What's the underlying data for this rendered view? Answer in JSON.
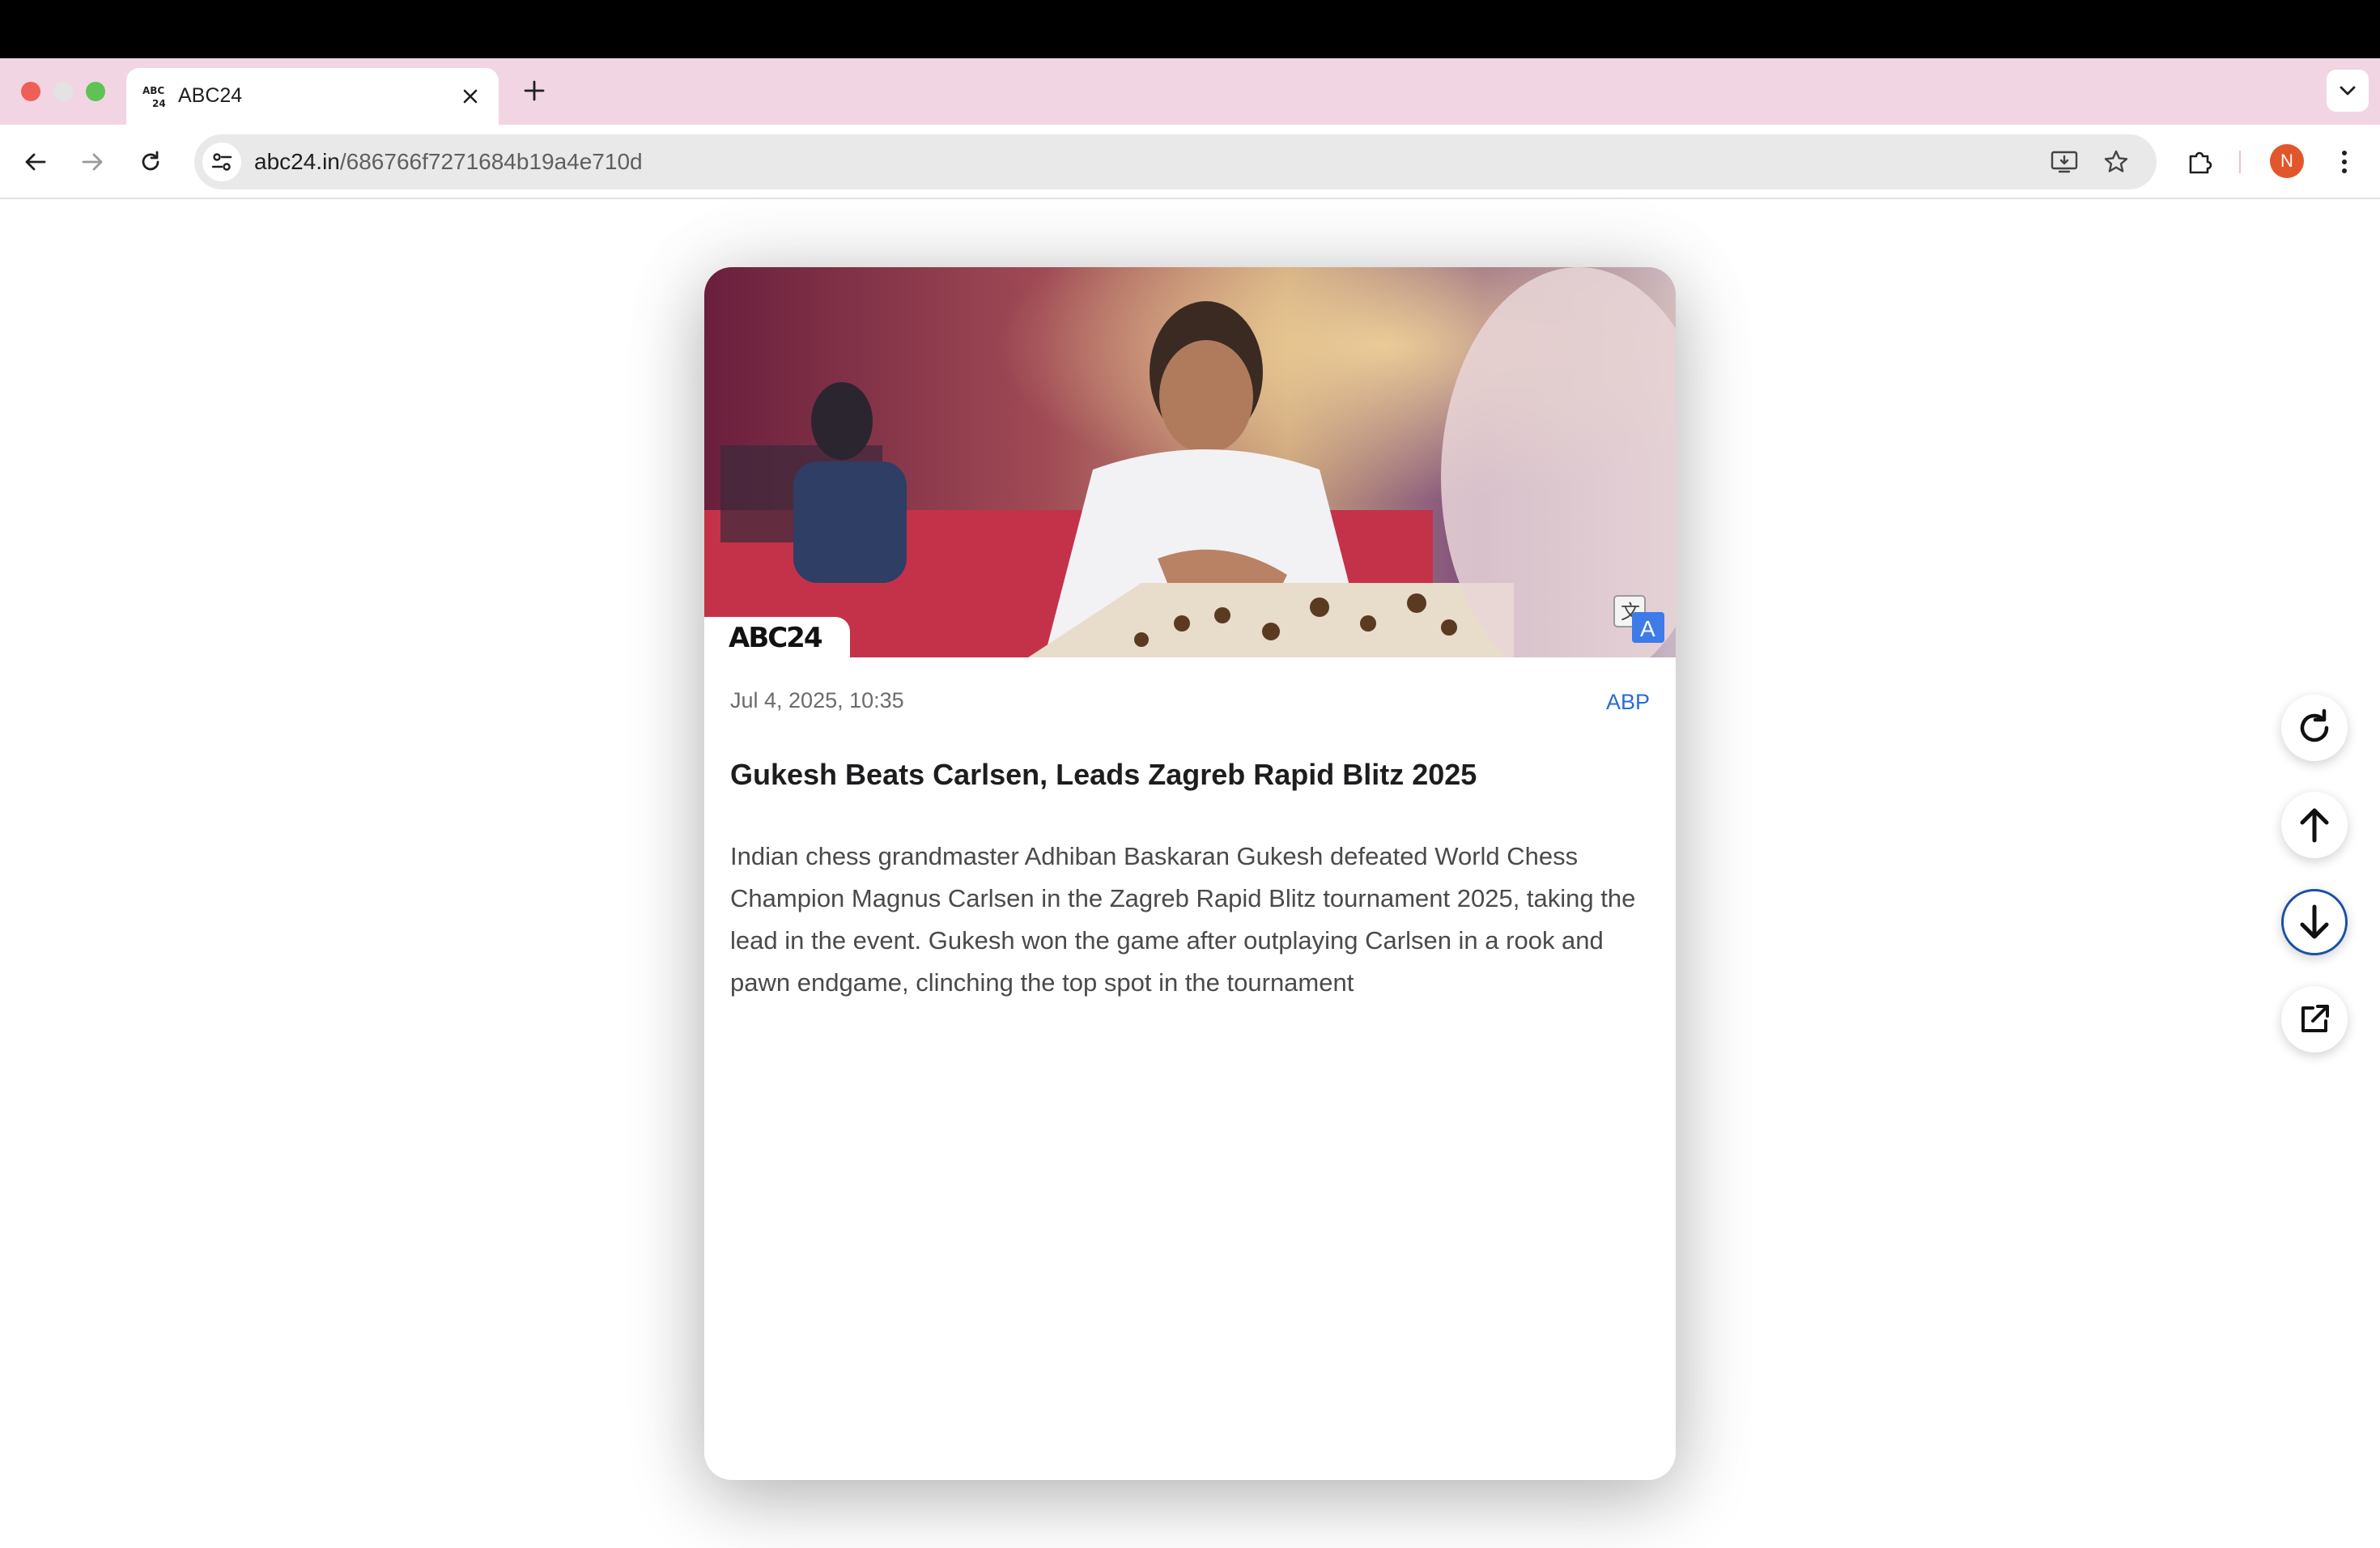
{
  "browser": {
    "tab": {
      "title": "ABC24"
    },
    "url": {
      "host": "abc24.in",
      "path": "/686766f7271684b19a4e710d"
    },
    "profile_initial": "N"
  },
  "card": {
    "brand": "ABC24",
    "date": "Jul 4, 2025, 10:35",
    "source": "ABP",
    "headline": "Gukesh Beats Carlsen, Leads Zagreb Rapid Blitz 2025",
    "summary": "Indian chess grandmaster Adhiban Baskaran Gukesh defeated World Chess Champion Magnus Carlsen in the Zagreb Rapid Blitz tournament 2025, taking the lead in the event. Gukesh won the game after outplaying Carlsen in a rook and pawn endgame, clinching the top spot in the tournament",
    "translate_badge": "A"
  },
  "controls": [
    "refresh-icon",
    "arrow-up-icon",
    "arrow-down-icon",
    "external-link-icon"
  ],
  "colors": {
    "tabstrip": "#f1d5e3",
    "link": "#2a6ad6",
    "avatar": "#e2562b",
    "active_ring": "#1b4fa8"
  }
}
